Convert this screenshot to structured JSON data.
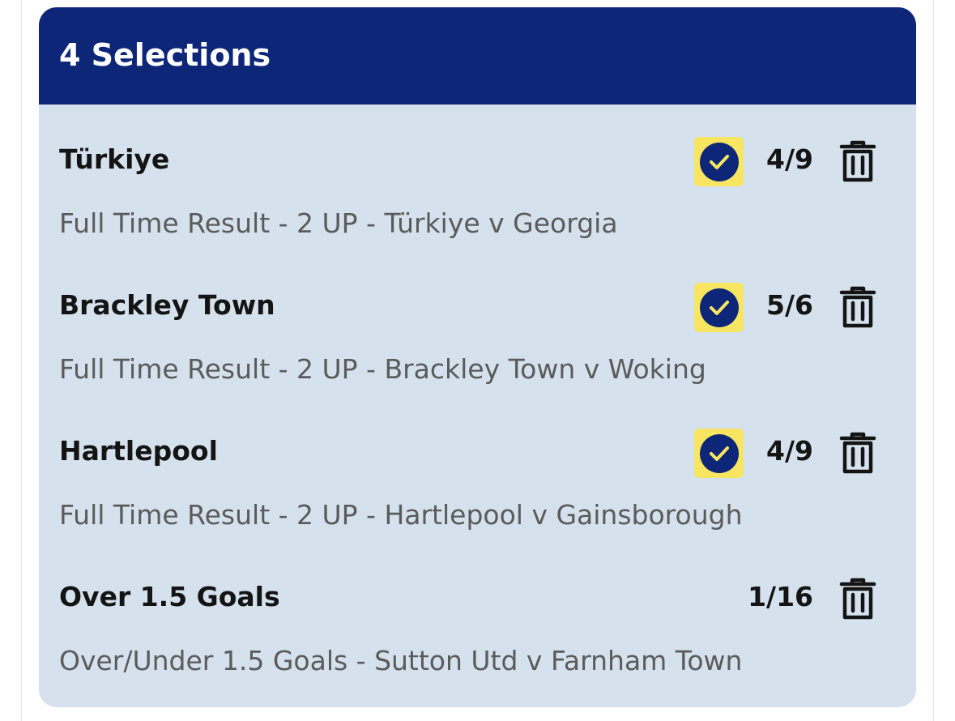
{
  "slip": {
    "title": "4 Selections",
    "colors": {
      "header_bg": "#0d2677",
      "card_bg": "#d5e1ed",
      "boost_bg": "#f8e663"
    },
    "selections": [
      {
        "name": "Türkiye",
        "odds": "4/9",
        "description": "Full Time Result - 2 UP - Türkiye v Georgia",
        "boost_icon": "check-circle-icon",
        "delete_icon": "trash-icon"
      },
      {
        "name": "Brackley Town",
        "odds": "5/6",
        "description": "Full Time Result - 2 UP - Brackley Town v Woking",
        "boost_icon": "check-circle-icon",
        "delete_icon": "trash-icon"
      },
      {
        "name": "Hartlepool",
        "odds": "4/9",
        "description": "Full Time Result - 2 UP - Hartlepool v Gainsborough",
        "boost_icon": "check-circle-icon",
        "delete_icon": "trash-icon"
      },
      {
        "name": "Over 1.5 Goals",
        "odds": "1/16",
        "description": "Over/Under 1.5 Goals - Sutton Utd v Farnham Town",
        "delete_icon": "trash-icon"
      }
    ]
  }
}
